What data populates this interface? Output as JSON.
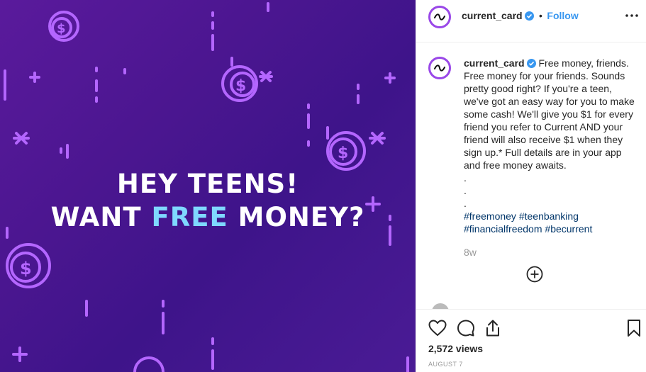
{
  "post": {
    "headline_line1": "HEY TEENS!",
    "headline_line2_pre": "WANT ",
    "headline_line2_accent": "FREE",
    "headline_line2_post": " MONEY?"
  },
  "header": {
    "username": "current_card",
    "separator": "•",
    "follow_label": "Follow",
    "more_icon": "more-icon"
  },
  "caption": {
    "username": "current_card",
    "text": "Free money, friends. Free money for your friends. Sounds pretty good right? If you're a teen, we've got an easy way for you to make some cash! We'll give you $1 for every friend you refer to Current AND your friend will also receive $1 when they sign up.* Full details are in your app and free money awaits.",
    "dots": [
      ".",
      ".",
      "."
    ],
    "hashtags_line1": [
      "#freemoney",
      "#teenbanking"
    ],
    "hashtags_line2": [
      "#financialfreedom",
      "#becurrent"
    ],
    "time_ago": "8w"
  },
  "load_more_icon": "plus-circle-icon",
  "actions": {
    "views": "2,572 views",
    "date": "AUGUST 7"
  },
  "colors": {
    "background_purple": "#4b1690",
    "decoration_violet": "#b466ff",
    "accent_text": "#7fd8ff",
    "link_blue": "#3897f0"
  }
}
